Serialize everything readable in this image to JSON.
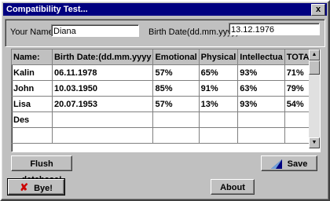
{
  "window": {
    "title": "Compatibility Test...",
    "close_glyph": "x"
  },
  "form": {
    "name_label": "Your Name:",
    "name_value": "Diana",
    "birth_label": "Birth Date(dd.mm.yyyy):",
    "birth_value": "13.12.1976"
  },
  "grid": {
    "columns": [
      "Name:",
      "Birth Date:(dd.mm.yyyy",
      "Emotional",
      "Physical",
      "Intellectua",
      "TOTAL!"
    ],
    "rows": [
      [
        "Kalin",
        "06.11.1978",
        "57%",
        "65%",
        "93%",
        "71%"
      ],
      [
        "John",
        "10.03.1950",
        "85%",
        "91%",
        "63%",
        "79%"
      ],
      [
        "Lisa",
        "20.07.1953",
        "57%",
        "13%",
        "93%",
        "54%"
      ],
      [
        "Des",
        "",
        "",
        "",
        "",
        ""
      ],
      [
        "",
        "",
        "",
        "",
        "",
        ""
      ]
    ]
  },
  "buttons": {
    "flush": "Flush database!",
    "save": "Save",
    "bye": "Bye!",
    "about": "About"
  },
  "icons": {
    "save": "save-icon",
    "bye": "x-icon"
  },
  "colors": {
    "titlebar": "#000080",
    "bye_x": "#cc0000",
    "save_icon": "#000080"
  }
}
